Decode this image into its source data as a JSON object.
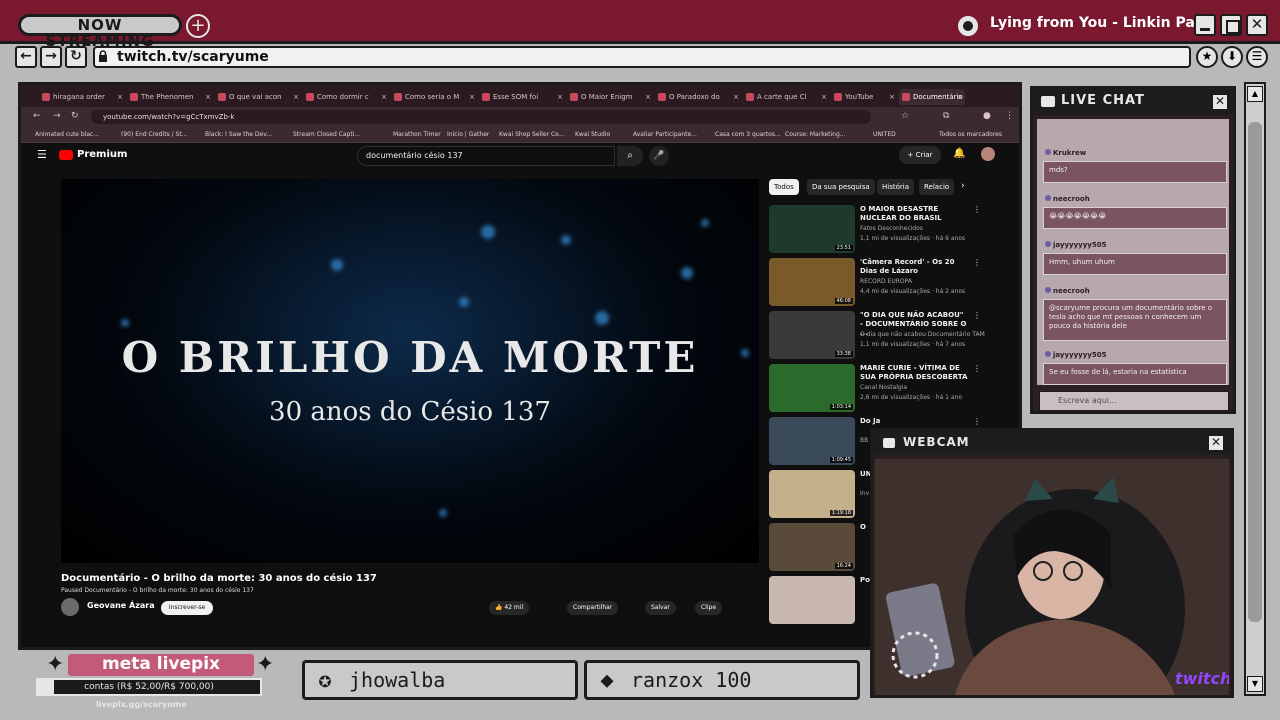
{
  "overlay": {
    "now_streaming": "NOW STREAMING",
    "plus": "+",
    "music": "Lying from You - Linkin Park",
    "url": "twitch.tv/scaryume",
    "close": "✕"
  },
  "chrome": {
    "tabs": [
      {
        "label": "hiragana order"
      },
      {
        "label": "The Phenomen"
      },
      {
        "label": "O que vai acon"
      },
      {
        "label": "Como dormir c"
      },
      {
        "label": "Como seria o M"
      },
      {
        "label": "Esse SOM foi"
      },
      {
        "label": "O Maior Enigm"
      },
      {
        "label": "O Paradoxo do"
      },
      {
        "label": "A carte que Cl"
      },
      {
        "label": "YouTube"
      },
      {
        "label": "Documentário"
      }
    ],
    "url": "youtube.com/watch?v=gCcTxmvZb-k",
    "bookmarks": [
      "Animated cute blac...",
      "(90) End Credits / St...",
      "Black: I Saw the Dev...",
      "Stream Closed Capti...",
      "Marathon Timer",
      "Início | Gather",
      "Kwai Shop Seller Ce...",
      "Kwai Studio",
      "Avaliar Participante...",
      "Casa com 3 quartos...",
      "Course: Marketing...",
      "UNITED",
      "Todos os marcadores"
    ]
  },
  "youtube": {
    "logo": "Premium",
    "search_value": "documentário césio 137",
    "create": "+ Criar",
    "video_overlay_title": "O BRILHO DA MORTE",
    "video_overlay_subtitle": "30 anos do Césio 137",
    "video_title": "Documentário - O brilho da morte: 30 anos do césio 137",
    "paused_label": "Paused Documentário - O brilho da morte: 30 anos do césio 137",
    "channel": "Geovane Ázara",
    "subscribe": "Inscrever-se",
    "likes": "42 mil",
    "share": "Compartilhar",
    "save": "Salvar",
    "clip": "Clipe",
    "chips": [
      "Todos",
      "Da sua pesquisa",
      "História",
      "Relacio"
    ],
    "recs": [
      {
        "title": "O MAIOR DESASTRE NUCLEAR DO BRASIL",
        "channel": "Fatos Desconhecidos",
        "meta": "1,1 mi de visualizações · há 6 anos",
        "duration": "23:51"
      },
      {
        "title": "'Câmera Record' - Os 20 Dias de Lázaro",
        "channel": "RECORD EUROPA",
        "meta": "4,4 mi de visualizações · há 2 anos",
        "duration": "46:08"
      },
      {
        "title": "\"O DIA QUE NÃO ACABOU\" - DOCUMENTÁRIO SOBRE O ...",
        "channel": "O dia que não acabou Documentário TAM",
        "meta": "1,1 mi de visualizações · há 7 anos",
        "duration": "33:38"
      },
      {
        "title": "MARIE CURIE - VÍTIMA DE SUA PRÓPRIA DESCOBERTA",
        "channel": "Canal Nostalgia",
        "meta": "2,6 mi de visualizações · há 1 ano",
        "duration": "1:03:14"
      },
      {
        "title": "Do Ja",
        "channel": "BB",
        "meta": "",
        "duration": "1:09:45"
      },
      {
        "title": "UN",
        "channel": "Inv",
        "meta": "",
        "duration": "1:19:18"
      },
      {
        "title": "O",
        "channel": "",
        "meta": "",
        "duration": "16:24"
      },
      {
        "title": "Po HU",
        "channel": "",
        "meta": "",
        "duration": ""
      }
    ]
  },
  "chat": {
    "title": "LIVE CHAT",
    "messages": [
      {
        "user": "Krukrew",
        "text": "mds?"
      },
      {
        "user": "neecrooh",
        "text": "😭😭😭😭😭😭😭"
      },
      {
        "user": "jayyyyyyy505",
        "text": "Hmm, uhum uhum"
      },
      {
        "user": "neecrooh",
        "text": "@scaryume procura um documentário sobre o tesla acho que mt pessoas n conhecem um pouco da história dele"
      },
      {
        "user": "jayyyyyyy505",
        "text": "Se eu fosse de lá, estaria na estatística"
      }
    ],
    "input_placeholder": "Escreva aqui..."
  },
  "webcam": {
    "title": "WEBCAM",
    "brand": "twitch"
  },
  "widgets": {
    "livepix_title": "meta livepix",
    "livepix_goal": "contas (R$ 52,00/R$ 700,00)",
    "livepix_progress": 0.0743,
    "livepix_url": "livepix.gg/scaryume",
    "card1_name": "jhowalba",
    "card2_name": "ranzox  100"
  },
  "colors": {
    "overlay_maroon": "#7a1830",
    "chat_message_bg": "#7a5560",
    "youtube_red": "#ff0000",
    "twitch_purple": "#9146ff"
  }
}
